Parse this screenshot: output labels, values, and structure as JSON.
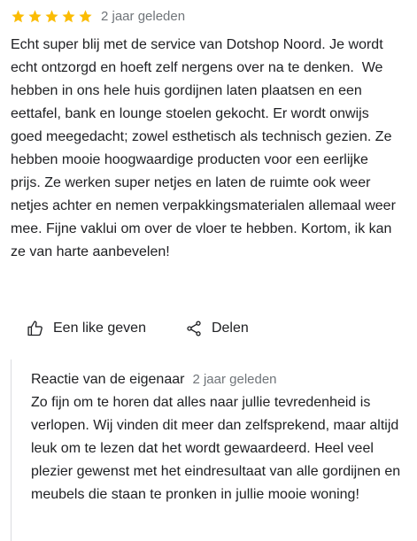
{
  "review": {
    "rating": 5,
    "star_color": "#fbbc04",
    "time_ago": "2 jaar geleden",
    "text": "Echt super blij met de service van Dotshop Noord. Je wordt echt ontzorgd en hoeft zelf nergens over na te denken.  We hebben in ons hele huis gordijnen laten plaatsen en een eettafel, bank en lounge stoelen gekocht. Er wordt onwijs goed meegedacht; zowel esthetisch als technisch gezien. Ze hebben mooie hoogwaardige producten voor een eerlijke prijs. Ze werken super netjes en laten de ruimte ook weer netjes achter en nemen verpakkingsmaterialen allemaal weer mee. Fijne vaklui om over de vloer te hebben. Kortom, ik kan ze van harte aanbevelen!"
  },
  "actions": {
    "like_label": "Een like geven",
    "like_icon": "thumb-up-icon",
    "share_label": "Delen",
    "share_icon": "share-icon"
  },
  "owner_reply": {
    "heading": "Reactie van de eigenaar",
    "time_ago": "2 jaar geleden",
    "text": "Zo fijn om te horen dat alles naar jullie tevredenheid is verlopen. Wij vinden dit meer dan zelfsprekend, maar altijd leuk om te lezen dat het wordt gewaardeerd. Heel veel plezier gewenst met het eindresultaat van alle gordijnen en meubels die staan te pronken in jullie mooie woning!"
  }
}
